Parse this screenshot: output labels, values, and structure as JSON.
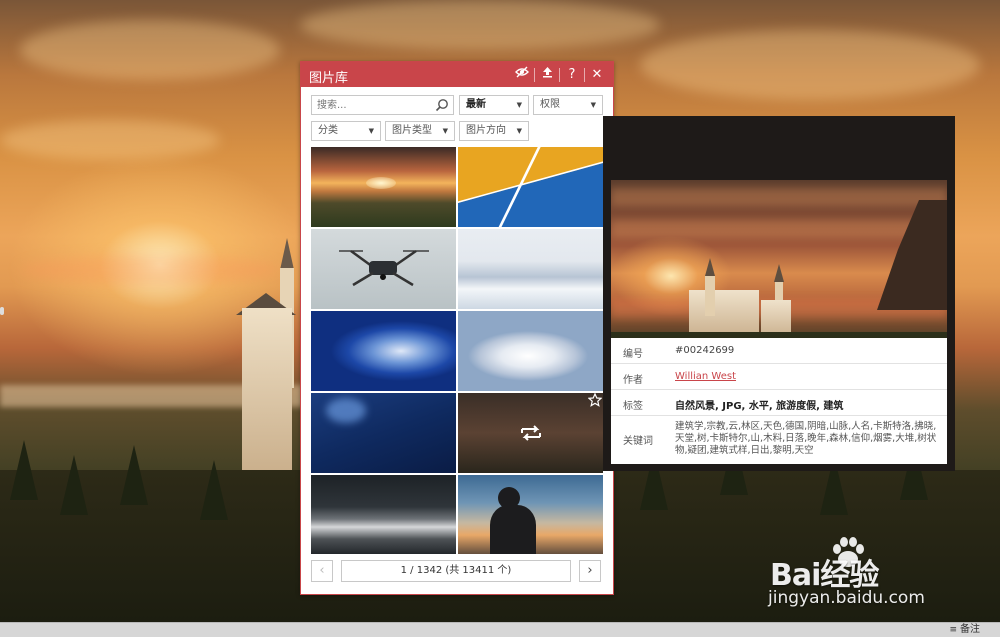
{
  "panel": {
    "title": "图片库",
    "titlebar_icons": [
      "eye-off-icon",
      "upload-icon",
      "help-icon",
      "close-icon"
    ],
    "help_glyph": "?",
    "close_glyph": "✕",
    "accent_color": "#c9454a"
  },
  "filters": {
    "search_placeholder": "搜索...",
    "sort": "最新",
    "license": "权限",
    "category": "分类",
    "image_type": "图片类型",
    "orientation": "图片方向"
  },
  "thumbnails": [
    {
      "name": "sunset-field"
    },
    {
      "name": "yellow-court"
    },
    {
      "name": "drone"
    },
    {
      "name": "snowy-trees"
    },
    {
      "name": "blue-sky-clouds"
    },
    {
      "name": "white-clouds"
    },
    {
      "name": "dark-blue-sky"
    },
    {
      "name": "castle-hovered"
    },
    {
      "name": "train-station"
    },
    {
      "name": "silhouette-person"
    }
  ],
  "pager": {
    "prev_glyph": "‹",
    "next_glyph": "›",
    "info": "1 / 1342 (共 13411 个)"
  },
  "preview": {
    "id_label": "编号",
    "id_value": "#00242699",
    "author_label": "作者",
    "author_value": "Willian West",
    "tags_label": "标签",
    "tags_value": "自然风景, JPG, 水平, 旅游度假, 建筑",
    "keywords_label": "关键词",
    "keywords_value": "建筑学,宗教,云,林区,天色,德国,阴暗,山脉,人名,卡斯特洛,拂晓,天堂,树,卡斯特尔,山,木料,日落,晚年,森林,信仰,烟雾,大堆,树状物,疑团,建筑式样,日出,黎明,天空"
  },
  "statusbar": {
    "notes_label": "备注"
  },
  "watermark": {
    "brand": "Bai经验",
    "url": "jingyan.baidu.com"
  }
}
